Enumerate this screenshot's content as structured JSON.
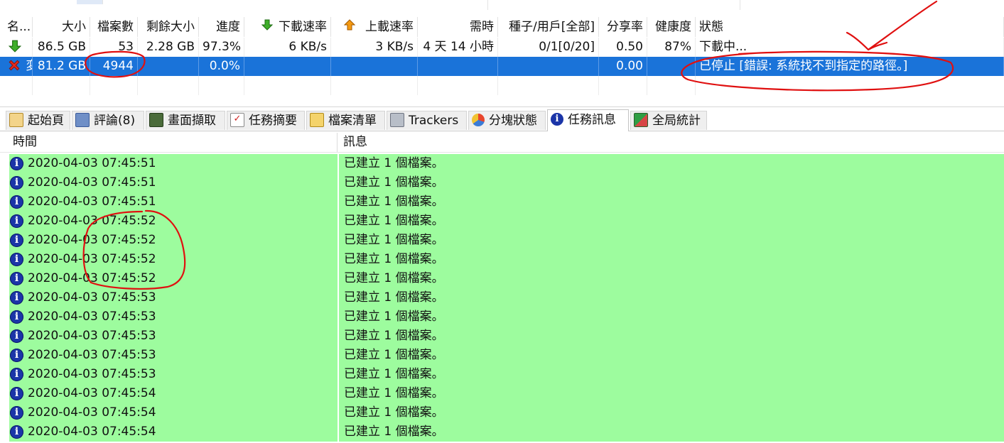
{
  "torrents": {
    "columns": {
      "name": "名...",
      "size": "大小",
      "files": "檔案數",
      "remaining": "剩餘大小",
      "progress": "進度",
      "download_speed": "下載速率",
      "upload_speed": "上載速率",
      "eta": "需時",
      "seeds_peers": "種子/用戶[全部]",
      "ratio": "分享率",
      "health": "健康度",
      "status": "狀態"
    },
    "rows": [
      {
        "icon": "download-arrow-icon",
        "name": "",
        "size": "86.5 GB",
        "files": "53",
        "remaining": "2.28 GB",
        "progress": "97.3%",
        "download_speed": "6 KB/s",
        "upload_speed": "3 KB/s",
        "eta": "4 天 14 小時",
        "seeds_peers": "0/1[0/20]",
        "ratio": "0.50",
        "health": "87%",
        "status": "下載中..."
      },
      {
        "icon": "error-x-icon",
        "name": "変",
        "size": "81.2 GB",
        "files": "4944",
        "remaining": "",
        "progress": "0.0%",
        "download_speed": "",
        "upload_speed": "",
        "eta": "",
        "seeds_peers": "",
        "ratio": "0.00",
        "health": "",
        "status": "已停止 [錯誤: 系統找不到指定的路徑。]"
      }
    ]
  },
  "tabs": [
    {
      "label": "起始頁",
      "icon": "home-page-icon"
    },
    {
      "label": "評論(8)",
      "icon": "comments-icon"
    },
    {
      "label": "畫面擷取",
      "icon": "screenshot-icon"
    },
    {
      "label": "任務摘要",
      "icon": "task-summary-icon"
    },
    {
      "label": "檔案清單",
      "icon": "file-list-icon"
    },
    {
      "label": "Trackers",
      "icon": "trackers-icon"
    },
    {
      "label": "分塊狀態",
      "icon": "pieces-chart-icon"
    },
    {
      "label": "任務訊息",
      "icon": "info-icon",
      "active": true
    },
    {
      "label": "全局統計",
      "icon": "global-stats-icon"
    }
  ],
  "log": {
    "columns": {
      "time": "時間",
      "message": "訊息"
    },
    "entries": [
      {
        "time": "2020-04-03 07:45:51",
        "message": "已建立 1 個檔案。"
      },
      {
        "time": "2020-04-03 07:45:51",
        "message": "已建立 1 個檔案。"
      },
      {
        "time": "2020-04-03 07:45:51",
        "message": "已建立 1 個檔案。"
      },
      {
        "time": "2020-04-03 07:45:52",
        "message": "已建立 1 個檔案。"
      },
      {
        "time": "2020-04-03 07:45:52",
        "message": "已建立 1 個檔案。"
      },
      {
        "time": "2020-04-03 07:45:52",
        "message": "已建立 1 個檔案。"
      },
      {
        "time": "2020-04-03 07:45:52",
        "message": "已建立 1 個檔案。"
      },
      {
        "time": "2020-04-03 07:45:53",
        "message": "已建立 1 個檔案。"
      },
      {
        "time": "2020-04-03 07:45:53",
        "message": "已建立 1 個檔案。"
      },
      {
        "time": "2020-04-03 07:45:53",
        "message": "已建立 1 個檔案。"
      },
      {
        "time": "2020-04-03 07:45:53",
        "message": "已建立 1 個檔案。"
      },
      {
        "time": "2020-04-03 07:45:53",
        "message": "已建立 1 個檔案。"
      },
      {
        "time": "2020-04-03 07:45:54",
        "message": "已建立 1 個檔案。"
      },
      {
        "time": "2020-04-03 07:45:54",
        "message": "已建立 1 個檔案。"
      },
      {
        "time": "2020-04-03 07:45:54",
        "message": "已建立 1 個檔案。"
      }
    ]
  },
  "colors": {
    "selection": "#1a73d9",
    "log_row_bg": "#9dfc9e",
    "annotation_red": "#e01010"
  }
}
